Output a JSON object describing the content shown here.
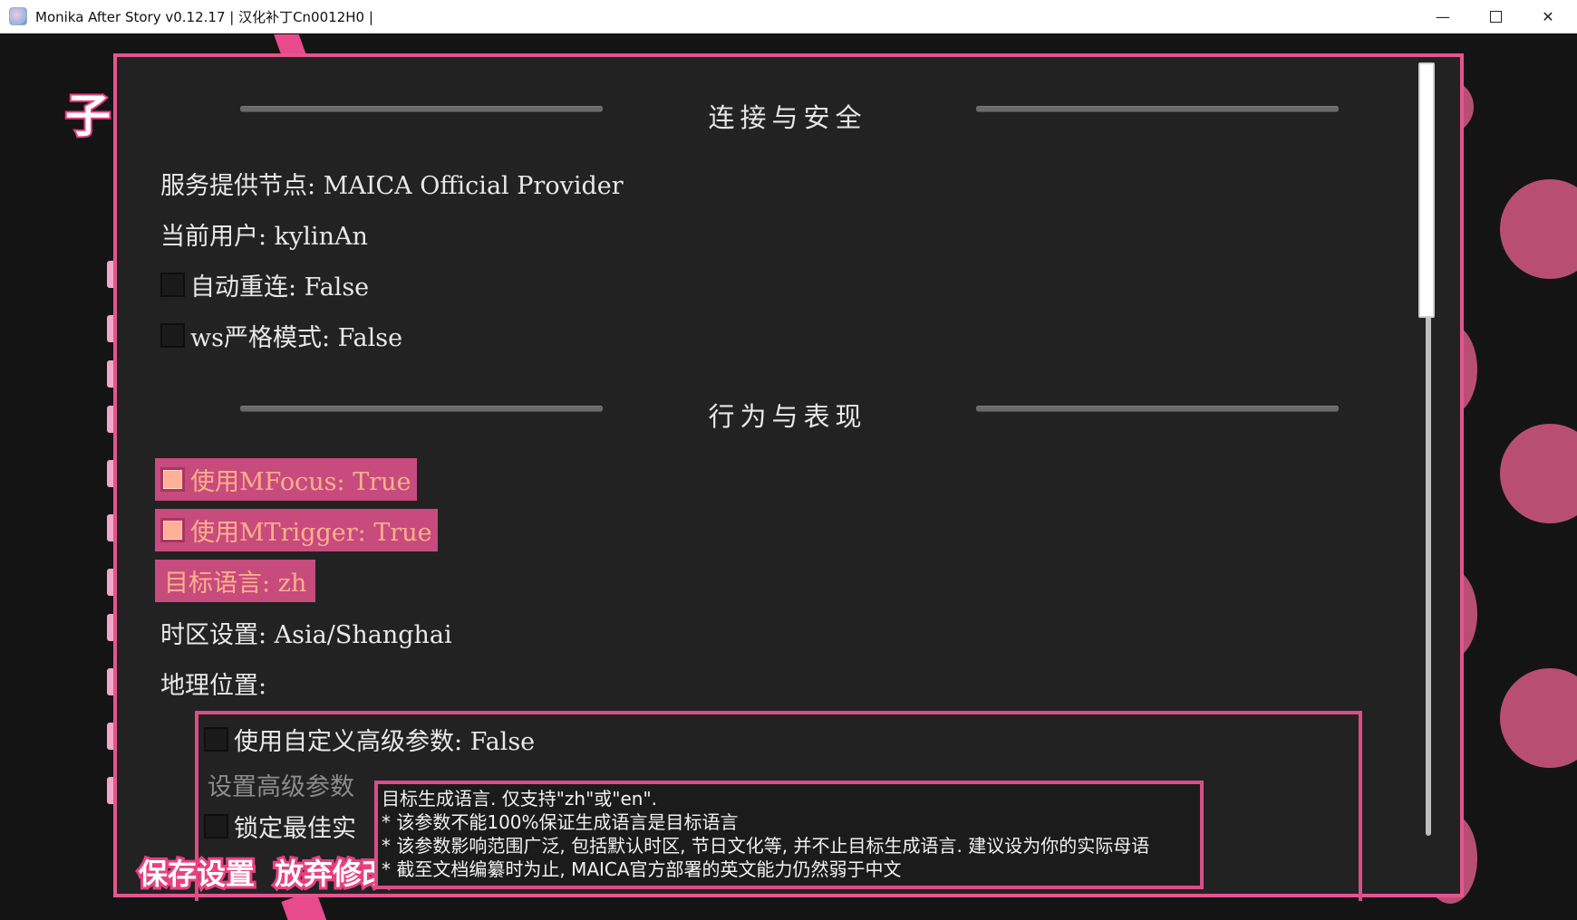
{
  "window": {
    "title": "Monika After Story v0.12.17 | 汉化补丁Cn0012H0 |",
    "minimize": "—",
    "close": "✕"
  },
  "backdrop": {
    "side_glyph": "子",
    "accent_color": "#e4558d",
    "dot_color": "#b84f73"
  },
  "sections": {
    "connection_title": "连接与安全",
    "behavior_title": "行为与表现"
  },
  "connection": {
    "provider": "服务提供节点: MAICA Official Provider",
    "user": "当前用户: kylinAn",
    "auto_reconnect": "自动重连: False",
    "ws_strict": "ws严格模式: False"
  },
  "behavior": {
    "mfocus": "使用MFocus: True",
    "mtrigger": "使用MTrigger: True",
    "target_language": "目标语言: zh",
    "timezone": "时区设置: Asia/Shanghai",
    "location": "地理位置:"
  },
  "advanced": {
    "use_custom": "使用自定义高级参数: False",
    "set_params": "设置高级参数",
    "lock_best": "锁定最佳实"
  },
  "buttons": {
    "save": "保存设置",
    "discard": "放弃修改"
  },
  "tooltip": {
    "lines": [
      "目标生成语言. 仅支持\"zh\"或\"en\".",
      "* 该参数不能100%保证生成语言是目标语言",
      "* 该参数影响范围广泛, 包括默认时区, 节日文化等, 并不止目标生成语言. 建议设为你的实际母语",
      "* 截至文档编纂时为止, MAICA官方部署的英文能力仍然弱于中文"
    ]
  }
}
